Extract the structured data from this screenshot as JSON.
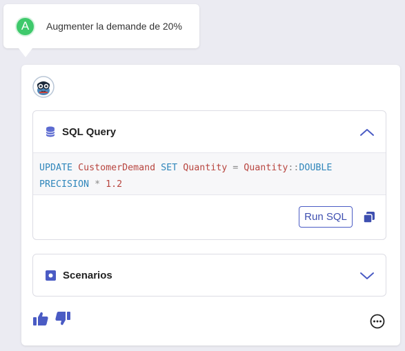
{
  "user_message": {
    "avatar_letter": "A",
    "text": "Augmenter la demande de 20%"
  },
  "assistant": {
    "avatar_icon": "bot-avatar-icon",
    "sql_panel": {
      "title": "SQL Query",
      "icon": "database-icon",
      "expanded": true,
      "code_line1": [
        "UPDATE",
        " ",
        "CustomerDemand",
        " ",
        "SET",
        " ",
        "Quantity",
        " = ",
        "Quantity",
        "::",
        "DOUBLE"
      ],
      "code_line2": [
        "PRECISION",
        " * ",
        "1.2"
      ],
      "run_button": "Run SQL",
      "copy_icon": "copy-icon"
    },
    "scenarios_panel": {
      "title": "Scenarios",
      "icon": "square-icon",
      "expanded": false
    },
    "footer": {
      "like_icon": "thumbs-up-icon",
      "dislike_icon": "thumbs-down-icon",
      "more_icon": "more-options-icon"
    }
  },
  "colors": {
    "accent": "#4a5bc4",
    "keyword": "#2f86bb",
    "identifier": "#b8453f",
    "user_avatar": "#3ec96b"
  }
}
